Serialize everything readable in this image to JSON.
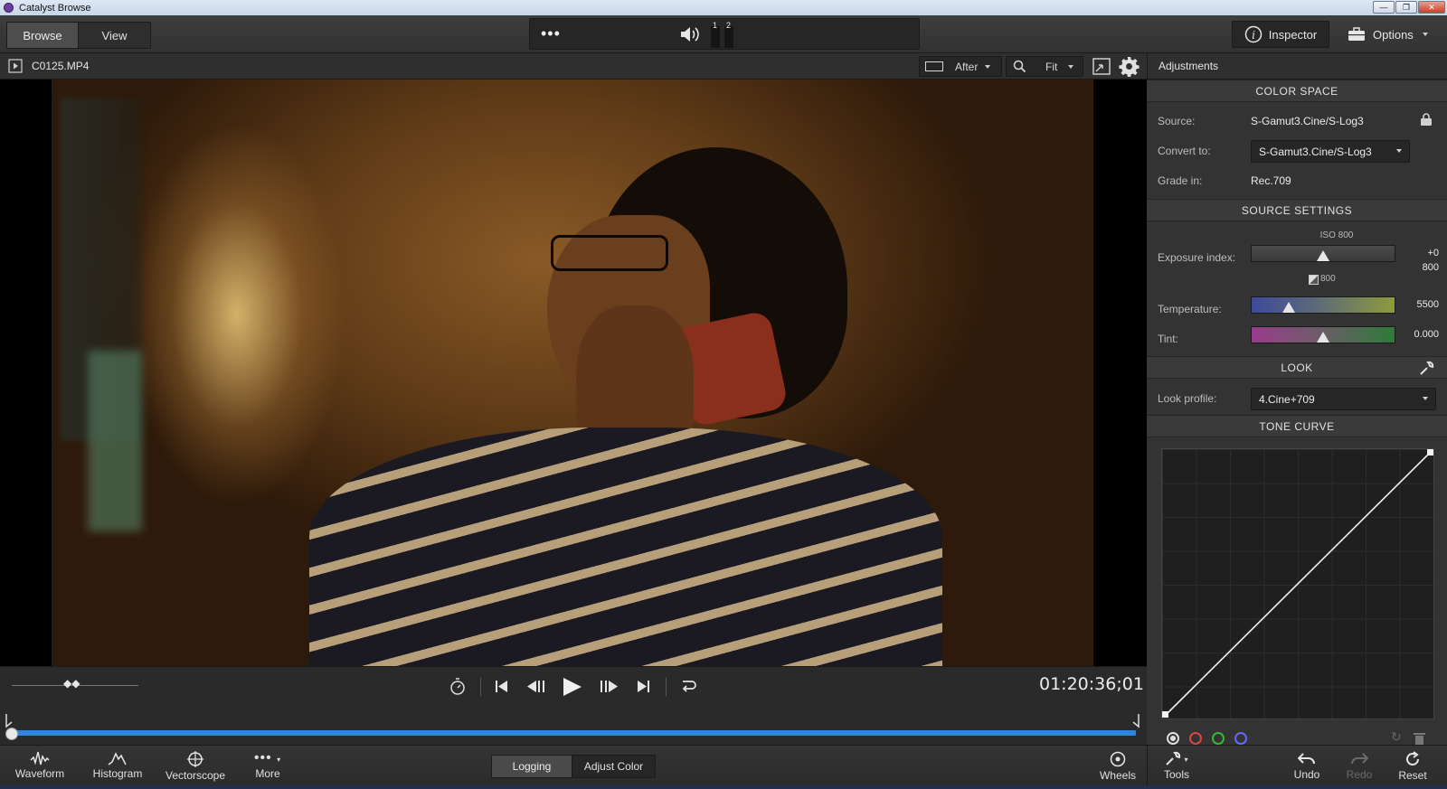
{
  "window": {
    "title": "Catalyst Browse"
  },
  "toolbar": {
    "modes": [
      {
        "label": "Browse",
        "active": true
      },
      {
        "label": "View",
        "active": false
      }
    ],
    "audio": {
      "channel_1": "1",
      "channel_2": "2"
    },
    "inspector_label": "Inspector",
    "options_label": "Options"
  },
  "viewer": {
    "clip_name": "C0125.MP4",
    "compare_mode": "After",
    "zoom": "Fit",
    "timecode": "01:20:36;01"
  },
  "panel": {
    "title": "Adjustments",
    "color_space": {
      "heading": "COLOR SPACE",
      "source_label": "Source:",
      "source_value": "S-Gamut3.Cine/S-Log3",
      "convert_label": "Convert to:",
      "convert_value": "S-Gamut3.Cine/S-Log3",
      "grade_label": "Grade in:",
      "grade_value": "Rec.709"
    },
    "source_settings": {
      "heading": "SOURCE SETTINGS",
      "iso_caption": "ISO 800",
      "exposure_label": "Exposure index:",
      "exposure_offset": "+0",
      "exposure_value": "800",
      "exposure_base": "800",
      "exposure_position": 0.5,
      "temperature_label": "Temperature:",
      "temperature_value": "5500",
      "temperature_position": 0.26,
      "tint_label": "Tint:",
      "tint_value": "0.000",
      "tint_position": 0.5
    },
    "look": {
      "heading": "LOOK",
      "profile_label": "Look profile:",
      "profile_value": "4.Cine+709"
    },
    "tone_curve": {
      "heading": "TONE CURVE"
    }
  },
  "bottom": {
    "scopes": [
      {
        "label": "Waveform",
        "icon": "waveform-icon"
      },
      {
        "label": "Histogram",
        "icon": "histogram-icon"
      },
      {
        "label": "Vectorscope",
        "icon": "vectorscope-icon"
      },
      {
        "label": "More",
        "icon": "more-icon"
      }
    ],
    "workspace_tabs": [
      {
        "label": "Logging",
        "active": true
      },
      {
        "label": "Adjust Color",
        "active": false
      }
    ],
    "wheels_label": "Wheels",
    "tools_label": "Tools",
    "undo_label": "Undo",
    "redo_label": "Redo",
    "reset_label": "Reset"
  },
  "colors": {
    "accent": "#2f86d6",
    "panel_bg": "#333333",
    "toolbar_bg": "#3a3a3a"
  }
}
